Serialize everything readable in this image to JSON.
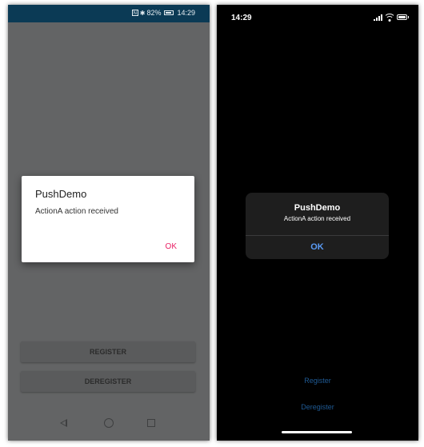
{
  "android": {
    "status": {
      "battery_percent": "82%",
      "time": "14:29",
      "nfc_glyph": "N",
      "battery_level": 0.82
    },
    "dialog": {
      "title": "PushDemo",
      "message": "ActionA action received",
      "ok_label": "OK"
    },
    "buttons": {
      "register": "REGISTER",
      "deregister": "DEREGISTER"
    },
    "nav_icons": [
      "back-icon",
      "home-icon",
      "recent-apps-icon"
    ],
    "colors": {
      "status_bar": "#0b3a55",
      "background": "#636465",
      "ok_accent": "#e91e63"
    }
  },
  "ios": {
    "status": {
      "time": "14:29"
    },
    "alert": {
      "title": "PushDemo",
      "message": "ActionA action received",
      "ok_label": "OK"
    },
    "links": {
      "register": "Register",
      "deregister": "Deregister"
    },
    "colors": {
      "background": "#000000",
      "alert_bg": "#1e1e1e",
      "ok_accent": "#5a9bf5",
      "link": "#1f5a94"
    }
  }
}
